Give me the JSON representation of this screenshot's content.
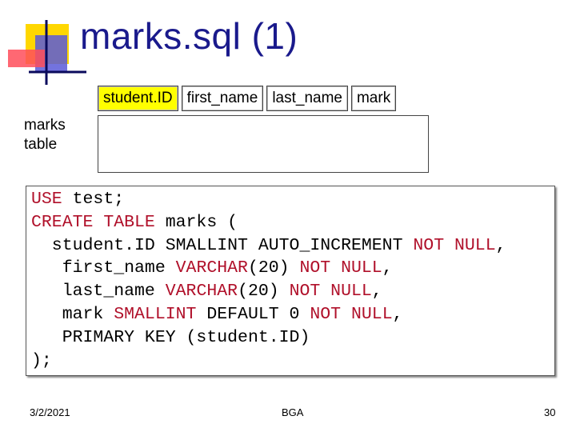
{
  "slide": {
    "title": "marks.sql (1)",
    "table_header": [
      "student.ID",
      "first_name",
      "last_name",
      "mark"
    ],
    "table_label_line1": "marks",
    "table_label_line2": "table",
    "code_lines": [
      [
        {
          "t": "USE",
          "kw": true
        },
        {
          "t": " test;",
          "kw": false
        }
      ],
      [
        {
          "t": "CREATE TABLE",
          "kw": true
        },
        {
          "t": " marks (",
          "kw": false
        }
      ],
      [
        {
          "t": "  student.ID SMALLINT AUTO_INCREMENT ",
          "kw": false
        },
        {
          "t": "NOT NULL",
          "kw": true
        },
        {
          "t": ",",
          "kw": false
        }
      ],
      [
        {
          "t": "   first_name ",
          "kw": false
        },
        {
          "t": "VARCHAR",
          "kw": true
        },
        {
          "t": "(20) ",
          "kw": false
        },
        {
          "t": "NOT NULL",
          "kw": true
        },
        {
          "t": ",",
          "kw": false
        }
      ],
      [
        {
          "t": "   last_name ",
          "kw": false
        },
        {
          "t": "VARCHAR",
          "kw": true
        },
        {
          "t": "(20) ",
          "kw": false
        },
        {
          "t": "NOT NULL",
          "kw": true
        },
        {
          "t": ",",
          "kw": false
        }
      ],
      [
        {
          "t": "   mark ",
          "kw": false
        },
        {
          "t": "SMALLINT",
          "kw": true
        },
        {
          "t": " DEFAULT 0 ",
          "kw": false
        },
        {
          "t": "NOT NULL",
          "kw": true
        },
        {
          "t": ",",
          "kw": false
        }
      ],
      [
        {
          "t": "   PRIMARY KEY (student.ID)",
          "kw": false
        }
      ],
      [
        {
          "t": ");",
          "kw": false
        }
      ]
    ]
  },
  "footer": {
    "date": "3/2/2021",
    "org": "BGA",
    "page": "30"
  },
  "colors": {
    "title": "#1a1a8c",
    "keyword": "#b0102a",
    "header_highlight": "#ffff00"
  },
  "icons": {
    "logo": "square-logo-icon"
  }
}
